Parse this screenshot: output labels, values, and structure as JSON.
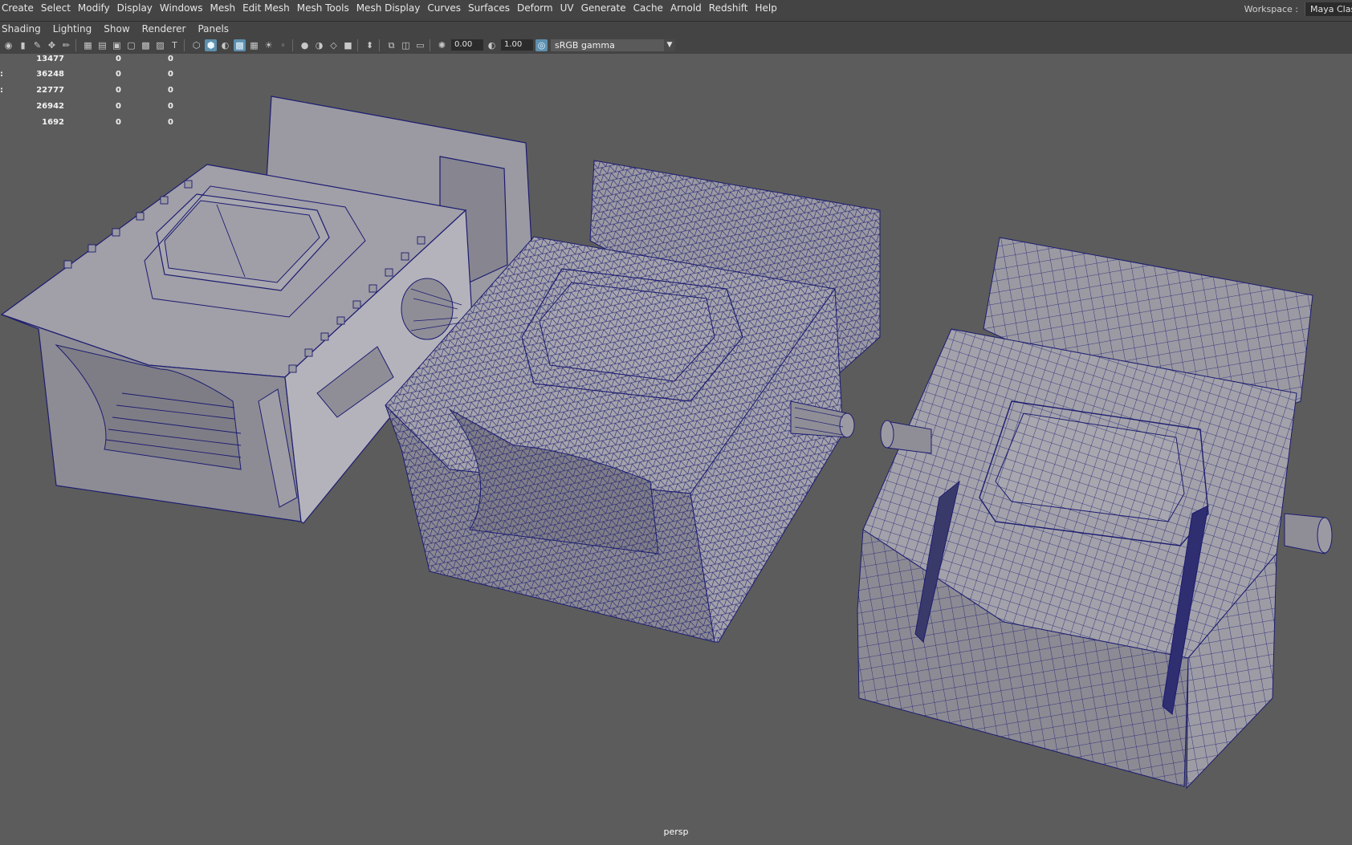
{
  "menu": {
    "items": [
      "Create",
      "Select",
      "Modify",
      "Display",
      "Windows",
      "Mesh",
      "Edit Mesh",
      "Mesh Tools",
      "Mesh Display",
      "Curves",
      "Surfaces",
      "Deform",
      "UV",
      "Generate",
      "Cache",
      "Arnold",
      "Redshift",
      "Help"
    ]
  },
  "workspace": {
    "label": "Workspace :",
    "value": "Maya Clas"
  },
  "panel_menu": {
    "items": [
      "Shading",
      "Lighting",
      "Show",
      "Renderer",
      "Panels"
    ]
  },
  "toolbar": {
    "exposure_value": "0.00",
    "gamma_value": "1.00",
    "color_space": "sRGB gamma",
    "icons": [
      "camera-icon",
      "bookmark-icon",
      "pen-icon",
      "move-icon",
      "brush-icon",
      "grid-icon",
      "film-gate-icon",
      "resolution-gate-icon",
      "gate-mask-icon",
      "field-chart-icon",
      "safe-action-icon",
      "safe-title-icon",
      "wireframe-icon",
      "smooth-shade-icon",
      "wireframe-on-shaded-icon",
      "textured-icon",
      "use-all-lights-icon",
      "shadows-icon",
      "screen-space-ao-icon",
      "motion-blur-icon",
      "multisample-icon",
      "dof-icon",
      "isolate-select-icon",
      "xray-icon",
      "xray-joints-icon",
      "xray-components-icon",
      "exposure-icon",
      "gamma-icon",
      "color-management-icon"
    ]
  },
  "heads_up": {
    "rows": [
      {
        "key": "",
        "a": "13477",
        "b": "0",
        "c": "0"
      },
      {
        "key": ":",
        "a": "36248",
        "b": "0",
        "c": "0"
      },
      {
        "key": ":",
        "a": "22777",
        "b": "0",
        "c": "0"
      },
      {
        "key": "",
        "a": "26942",
        "b": "0",
        "c": "0"
      },
      {
        "key": "",
        "a": "1692",
        "b": "0",
        "c": "0"
      }
    ]
  },
  "viewport": {
    "camera": "persp",
    "background_color": "#5c5c5c",
    "mesh_color": "#9b9aa3",
    "wire_color": "#1c1c70"
  }
}
